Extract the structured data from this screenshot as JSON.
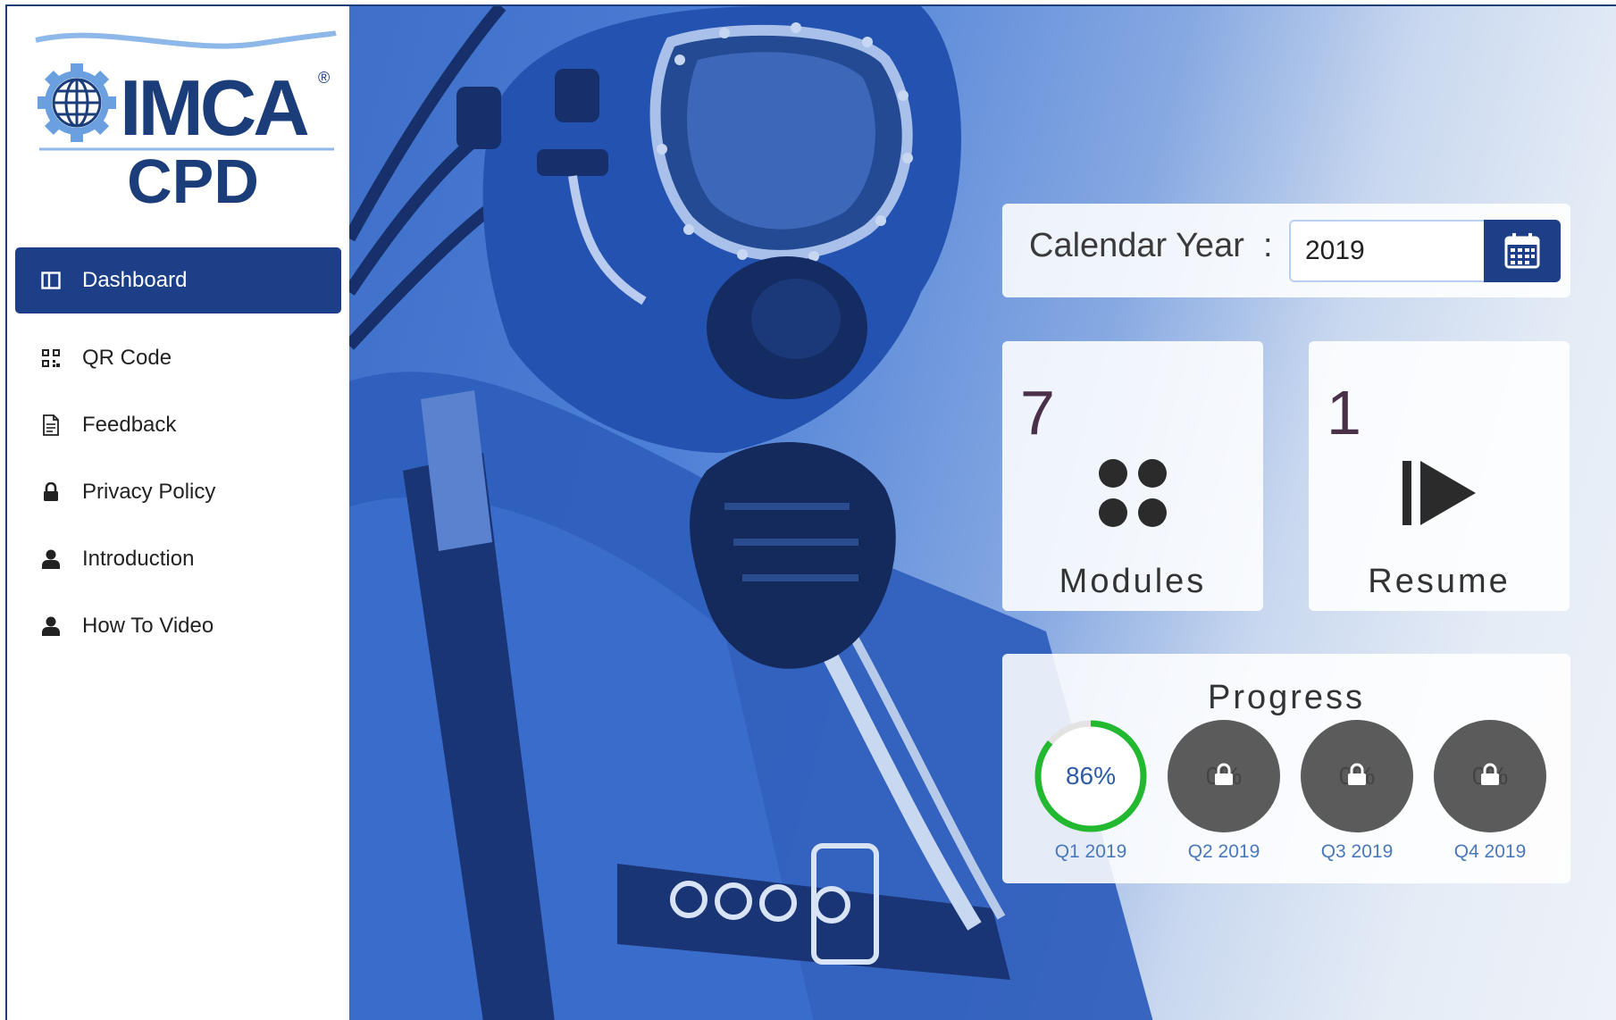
{
  "brand": {
    "logo_text": "IMCA",
    "logo_sub": "CPD",
    "logo_mark": "®"
  },
  "sidebar": {
    "items": [
      {
        "label": "Dashboard",
        "icon": "columns-icon",
        "active": true
      },
      {
        "label": "QR Code",
        "icon": "qr-code-icon"
      },
      {
        "label": "Feedback",
        "icon": "document-icon"
      },
      {
        "label": "Privacy Policy",
        "icon": "lock-icon"
      },
      {
        "label": "Introduction",
        "icon": "user-icon"
      },
      {
        "label": "How To Video",
        "icon": "user-icon"
      }
    ]
  },
  "calendar": {
    "label": "Calendar Year",
    "separator": ":",
    "value": "2019",
    "icon": "calendar-icon"
  },
  "modules": {
    "count": "7",
    "label": "Modules",
    "icon": "grid-dots-icon"
  },
  "resume": {
    "count": "1",
    "label": "Resume",
    "icon": "play-next-icon"
  },
  "progress": {
    "title": "Progress",
    "quarters": [
      {
        "label": "Q1 2019",
        "percent_text": "86%",
        "percent": 86,
        "locked": false,
        "color": "#22b82f"
      },
      {
        "label": "Q2 2019",
        "percent_text": "0%",
        "percent": 0,
        "locked": true
      },
      {
        "label": "Q3 2019",
        "percent_text": "0%",
        "percent": 0,
        "locked": true
      },
      {
        "label": "Q4 2019",
        "percent_text": "0%",
        "percent": 0,
        "locked": true
      }
    ]
  },
  "colors": {
    "brand_blue": "#1c3f87",
    "logo_blue": "#1b4fa8",
    "progress_green": "#22b82f",
    "locked_grey": "#5b5b5b"
  }
}
